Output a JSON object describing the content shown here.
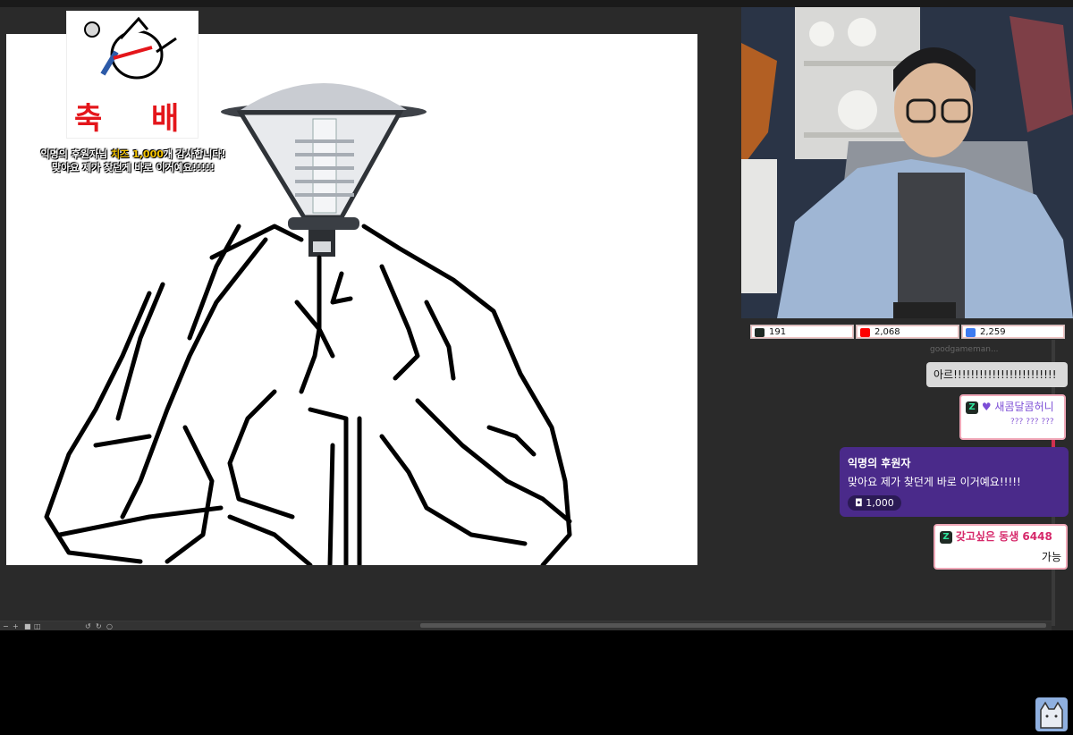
{
  "donation_alert": {
    "emblem_left": "축",
    "emblem_right": "배",
    "thanks_line1_a": "익명의 후원자님",
    "thanks_line1_highlight": "치즈 1,000",
    "thanks_line1_b": "개 감사합니다!",
    "thanks_line2": "맞아요 제가 찾던게 바로 이거예요!!!!!"
  },
  "stats": {
    "chzzk": "191",
    "youtube": "2,068",
    "other": "2,259"
  },
  "chat": {
    "partial_user": "goodgameman...",
    "msg1_text": "아르!!!!!!!!!!!!!!!!!!!!!!!!",
    "msg2_user": "새콤달콤허니",
    "msg2_text": "??? ??? ???",
    "donation_user": "익명의 후원자",
    "donation_text": "맞아요 제가 찾던게 바로 이거예요!!!!!",
    "donation_amount": "1,000",
    "msg3_user": "갖고싶은 동생 6448",
    "msg3_text": "가능"
  },
  "colors": {
    "accent_green": "#2ee59d",
    "youtube_red": "#ff0000",
    "donation_purple": "#4a2a8a",
    "emblem_red": "#e4161b"
  }
}
